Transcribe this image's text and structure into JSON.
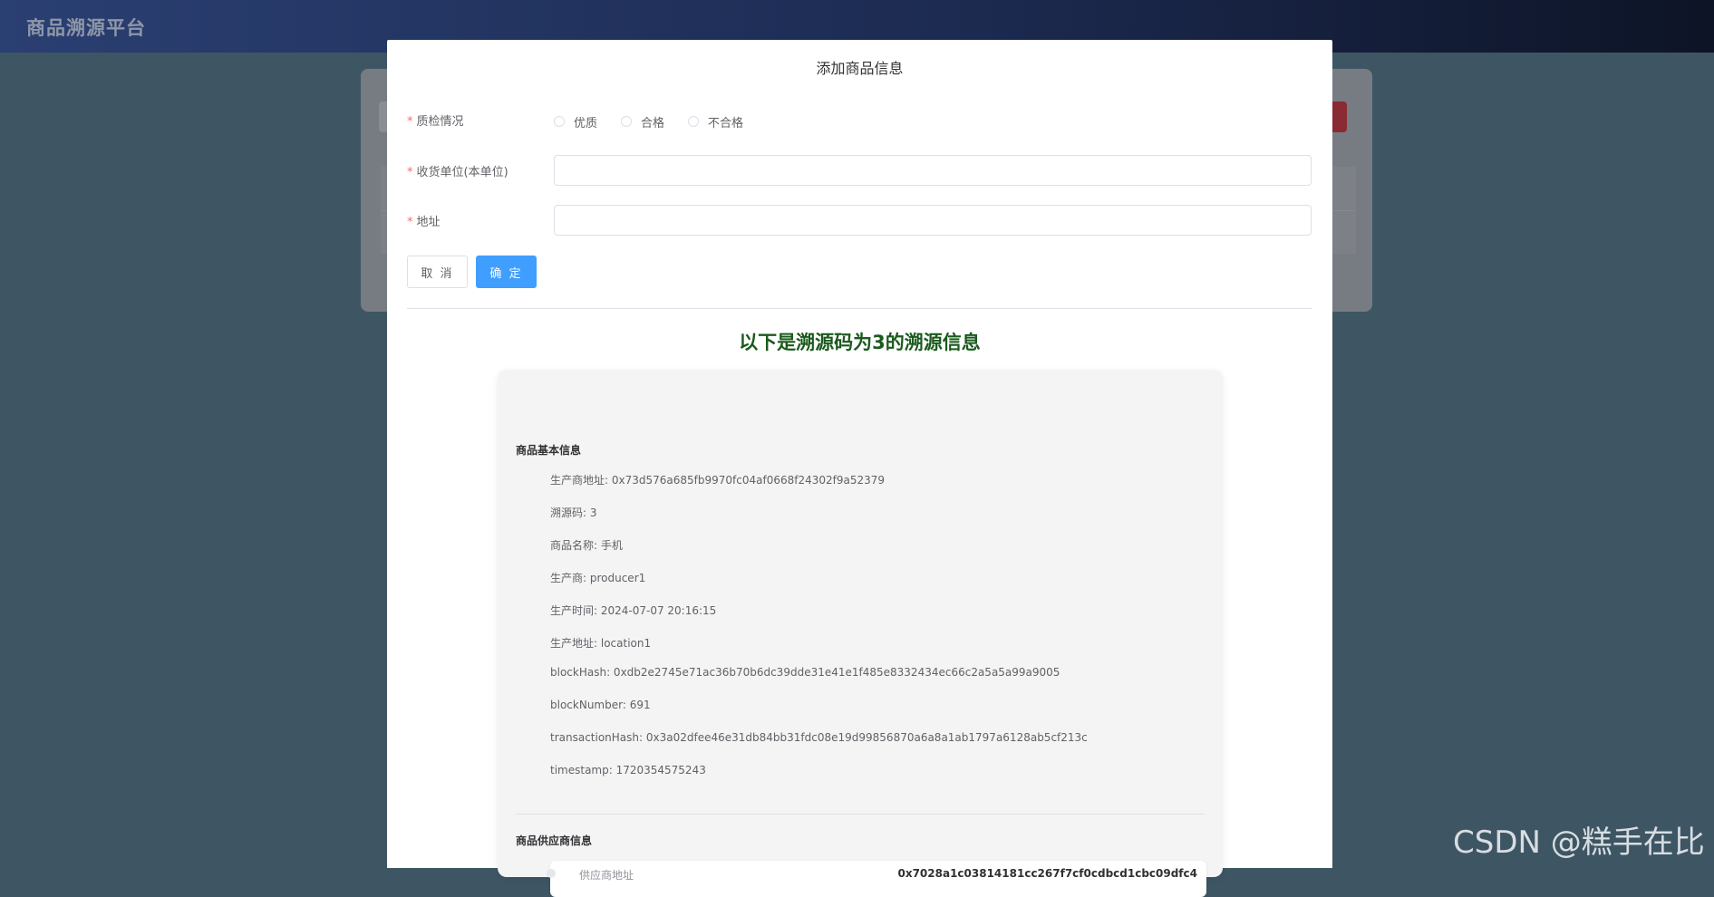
{
  "app": {
    "title": "商品溯源平台"
  },
  "modal": {
    "title": "添加商品信息",
    "quality": {
      "label": "质检情况",
      "options": [
        "优质",
        "合格",
        "不合格"
      ]
    },
    "receiver": {
      "label": "收货单位(本单位)",
      "value": ""
    },
    "address": {
      "label": "地址",
      "value": ""
    },
    "cancel_label": "取 消",
    "confirm_label": "确 定"
  },
  "trace": {
    "heading": "以下是溯源码为3的溯源信息",
    "basic": {
      "title": "商品基本信息",
      "lines": [
        "生产商地址: 0x73d576a685fb9970fc04af0668f24302f9a52379",
        "溯源码: 3",
        "商品名称: 手机",
        "生产商: producer1",
        "生产时间: 2024-07-07 20:16:15",
        "生产地址: location1",
        "blockHash: 0xdb2e2745e71ac36b70b6dc39dde31e41e1f485e8332434ec66c2a5a5a99a9005",
        "blockNumber: 691",
        "transactionHash: 0x3a02dfee46e31db84bb31fdc08e19d99856870a6a8a1ab1797a6128ab5cf213c",
        "timestamp: 1720354575243"
      ]
    },
    "supplier": {
      "title": "商品供应商信息",
      "address_label": "供应商地址",
      "address_value": "0x7028a1c03814181cc267f7cf0cdbcd1cbc09dfc4"
    }
  },
  "watermark": "CSDN @糕手在比"
}
